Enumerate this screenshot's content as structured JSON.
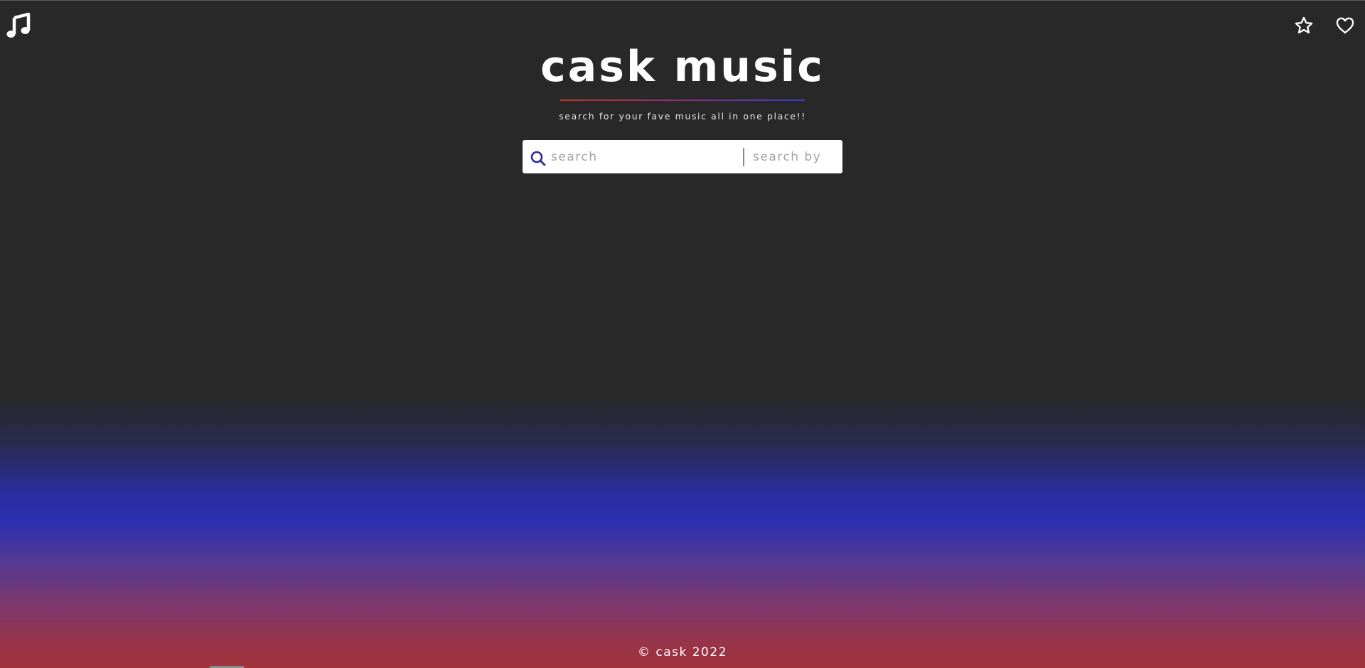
{
  "header": {
    "title": "cask music",
    "subtitle": "search for your fave music all in one place!!"
  },
  "nav": {
    "logo_icon": "music-note-icon",
    "favorites_icon": "star-icon",
    "likes_icon": "heart-icon"
  },
  "search": {
    "placeholder": "search",
    "value": "",
    "search_by_placeholder": "search by"
  },
  "footer": {
    "copyright": "© cask 2022"
  },
  "colors": {
    "background": "#282828",
    "gradient_blue": "#2b2fb0",
    "gradient_red": "#a0333c",
    "search_icon": "#2e2a9e",
    "text": "#ffffff"
  }
}
